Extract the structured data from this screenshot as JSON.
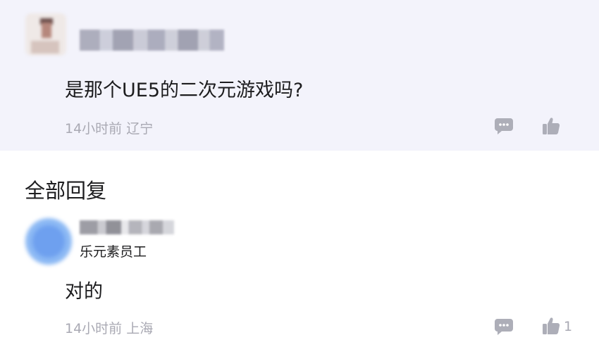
{
  "main_comment": {
    "text": "是那个UE5的二次元游戏吗?",
    "time": "14小时前",
    "location": "辽宁"
  },
  "section": {
    "title": "全部回复"
  },
  "reply": {
    "badge": "乐元素员工",
    "text": "对的",
    "time": "14小时前",
    "location": "上海",
    "likes": "1"
  },
  "icons": {
    "comment": "comment-bubble-icon",
    "like": "thumbs-up-icon"
  },
  "colors": {
    "top_background": "#f3f3fb",
    "meta_text": "#a9a9b3",
    "icon_color": "#adaeb8",
    "avatar_blue": "#6ea0ef"
  }
}
